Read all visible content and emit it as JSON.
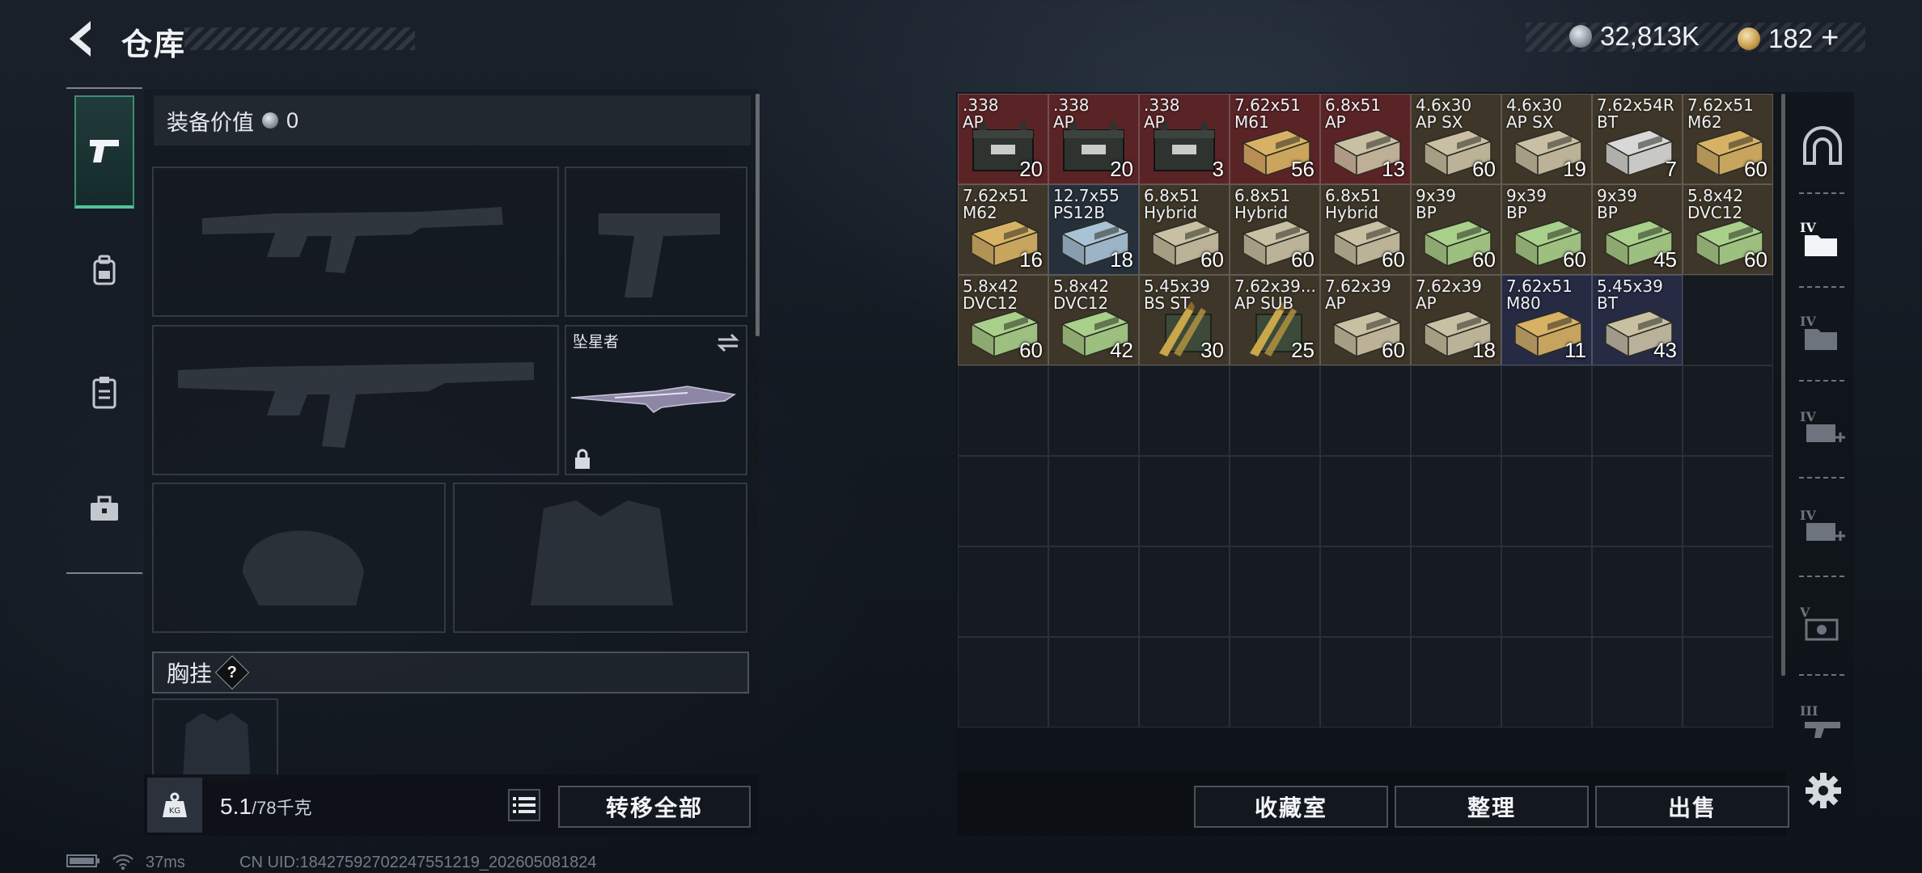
{
  "header": {
    "title": "仓库"
  },
  "currency": {
    "silver": "32,813K",
    "gold": "182",
    "add_label": "+"
  },
  "side_tabs": [
    "weapon",
    "backpack",
    "clipboard",
    "toolbox"
  ],
  "loadout": {
    "value_label": "装备价值",
    "value": "0",
    "melee_name": "坠星者",
    "chest_label": "胸挂",
    "help": "?",
    "weight_current": "5.1",
    "weight_max": "/78千克",
    "transfer_all": "转移全部"
  },
  "storage": {
    "items": [
      {
        "name": ".338\nAP",
        "qty": "20",
        "bg": "#5a2426",
        "box": "crate"
      },
      {
        "name": ".338\nAP",
        "qty": "20",
        "bg": "#5a2426",
        "box": "crate"
      },
      {
        "name": ".338\nAP",
        "qty": "3",
        "bg": "#5a2426",
        "box": "crate"
      },
      {
        "name": "7.62x51\nM61",
        "qty": "56",
        "bg": "#5a2426",
        "box": "ammo",
        "color": "#d8b264"
      },
      {
        "name": "6.8x51\nAP",
        "qty": "13",
        "bg": "#5a2426",
        "box": "ammo",
        "color": "#c9c0a4"
      },
      {
        "name": "4.6x30\nAP SX",
        "qty": "60",
        "bg": "#3e3628",
        "box": "ammo",
        "color": "#c9c0a4"
      },
      {
        "name": "4.6x30\nAP SX",
        "qty": "19",
        "bg": "#3e3628",
        "box": "ammo",
        "color": "#c9c0a4"
      },
      {
        "name": "7.62x54R\nBT",
        "qty": "7",
        "bg": "#3e3628",
        "box": "ammo",
        "color": "#d8d8d8"
      },
      {
        "name": "7.62x51\nM62",
        "qty": "60",
        "bg": "#3e3628",
        "box": "ammo",
        "color": "#d8b264"
      },
      {
        "name": "7.62x51\nM62",
        "qty": "16",
        "bg": "#3e3628",
        "box": "ammo",
        "color": "#d8b264"
      },
      {
        "name": "12.7x55\nPS12B",
        "qty": "18",
        "bg": "#26303b",
        "box": "ammo",
        "color": "#a9c3d6"
      },
      {
        "name": "6.8x51\nHybrid",
        "qty": "60",
        "bg": "#3e3628",
        "box": "ammo",
        "color": "#c9c0a4"
      },
      {
        "name": "6.8x51\nHybrid",
        "qty": "60",
        "bg": "#3e3628",
        "box": "ammo",
        "color": "#c9c0a4"
      },
      {
        "name": "6.8x51\nHybrid",
        "qty": "60",
        "bg": "#3e3628",
        "box": "ammo",
        "color": "#c9c0a4"
      },
      {
        "name": "9x39\nBP",
        "qty": "60",
        "bg": "#3e3628",
        "box": "ammo",
        "color": "#a8d08a"
      },
      {
        "name": "9x39\nBP",
        "qty": "60",
        "bg": "#3e3628",
        "box": "ammo",
        "color": "#a8d08a"
      },
      {
        "name": "9x39\nBP",
        "qty": "45",
        "bg": "#3e3628",
        "box": "ammo",
        "color": "#a8d08a"
      },
      {
        "name": "5.8x42\nDVC12",
        "qty": "60",
        "bg": "#3e3628",
        "box": "ammo",
        "color": "#a8d08a"
      },
      {
        "name": "5.8x42\nDVC12",
        "qty": "60",
        "bg": "#3e3628",
        "box": "ammo",
        "color": "#a8d08a"
      },
      {
        "name": "5.8x42\nDVC12",
        "qty": "42",
        "bg": "#3e3628",
        "box": "ammo",
        "color": "#a8d08a"
      },
      {
        "name": "5.45x39\nBS ST",
        "qty": "30",
        "bg": "#3e3628",
        "box": "rounds"
      },
      {
        "name": "7.62x39...\nAP SUB",
        "qty": "25",
        "bg": "#3e3628",
        "box": "rounds"
      },
      {
        "name": "7.62x39\nAP",
        "qty": "60",
        "bg": "#3e3628",
        "box": "ammo",
        "color": "#c9c0a4"
      },
      {
        "name": "7.62x39\nAP",
        "qty": "18",
        "bg": "#3e3628",
        "box": "ammo",
        "color": "#c9c0a4"
      },
      {
        "name": "7.62x51\nM80",
        "qty": "11",
        "bg": "#262a42",
        "box": "ammo",
        "color": "#d8b264"
      },
      {
        "name": "5.45x39\nBT",
        "qty": "43",
        "bg": "#262a42",
        "box": "ammo",
        "color": "#c9c0a4"
      }
    ],
    "total_cells": 63,
    "buttons": {
      "collection": "收藏室",
      "sort": "整理",
      "sell": "出售"
    }
  },
  "right_tabs": [
    "IV",
    "IV",
    "IV",
    "IV",
    "V",
    "III"
  ],
  "status": {
    "ping": "37ms",
    "uid": "CN UID:18427592702247551219_202605081824"
  }
}
